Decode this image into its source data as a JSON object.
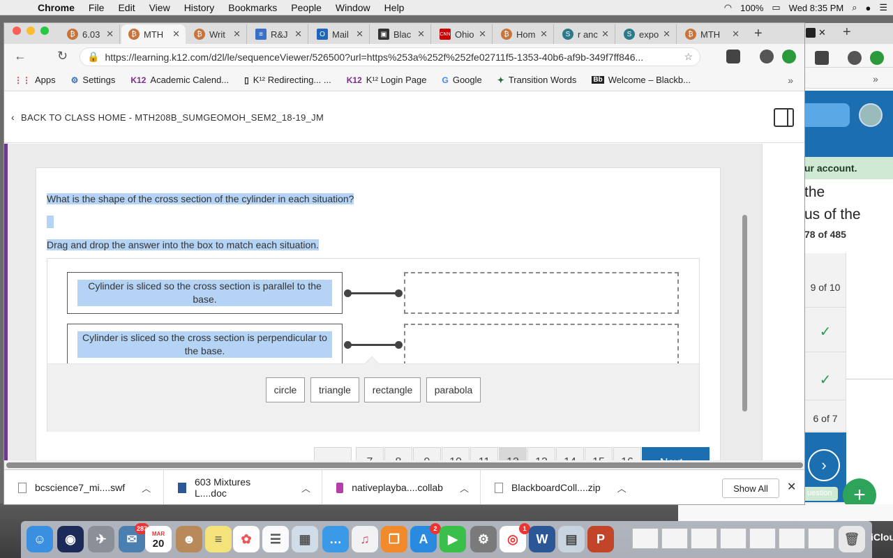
{
  "menubar": {
    "app": "Chrome",
    "items": [
      "File",
      "Edit",
      "View",
      "History",
      "Bookmarks",
      "People",
      "Window",
      "Help"
    ],
    "battery": "100%",
    "clock": "Wed 8:35 PM"
  },
  "tabs": [
    {
      "label": "6.03",
      "active": false
    },
    {
      "label": "MTH",
      "active": true
    },
    {
      "label": "Writ",
      "active": false
    },
    {
      "label": "R&J",
      "active": false
    },
    {
      "label": "Mail",
      "active": false
    },
    {
      "label": "Blac",
      "active": false
    },
    {
      "label": "Ohio",
      "active": false
    },
    {
      "label": "Hom",
      "active": false
    },
    {
      "label": "r anc",
      "active": false
    },
    {
      "label": "expo",
      "active": false
    },
    {
      "label": "MTH",
      "active": false
    }
  ],
  "address": {
    "url": "https://learning.k12.com/d2l/le/sequenceViewer/526500?url=https%253a%252f%252fe02711f5-1353-40b6-af9b-349f7ff846..."
  },
  "bookmarks": [
    {
      "icon": "apps-grid-icon",
      "label": "Apps"
    },
    {
      "icon": "gear-icon",
      "label": "Settings"
    },
    {
      "icon": "k12-icon",
      "label": "Academic Calend..."
    },
    {
      "icon": "page-icon",
      "label": "K¹² Redirecting... ..."
    },
    {
      "icon": "k12-icon",
      "label": "K¹² Login Page"
    },
    {
      "icon": "google-icon",
      "label": "Google"
    },
    {
      "icon": "feather-icon",
      "label": "Transition Words"
    },
    {
      "icon": "blackboard-icon",
      "label": "Welcome – Blackb..."
    }
  ],
  "page": {
    "back_label": "BACK TO CLASS HOME - MTH208B_SUMGEOMOH_SEM2_18-19_JM",
    "question": "What is the shape of the cross section of the cylinder in each situation?",
    "instruction": "Drag and drop the answer into the box to match each situation.",
    "prompts": [
      "Cylinder is sliced so the cross section is parallel to the base.",
      "Cylinder is sliced so the cross section is perpendicular to the base."
    ],
    "choices": [
      "circle",
      "triangle",
      "rectangle",
      "parabola"
    ],
    "pager": {
      "prev": "◂",
      "pages": [
        "7",
        "8",
        "9",
        "10",
        "11",
        "12",
        "13",
        "14",
        "15",
        "16"
      ],
      "current": "12",
      "next": "Next ▸"
    }
  },
  "background_window": {
    "banner": "ur account.",
    "line1": "the",
    "line2": "us of the",
    "count": "78 of 485",
    "row1": "9 of 10",
    "row4": "6 of 7",
    "pill": "uestion"
  },
  "downloads": [
    {
      "name": "bcscience7_mi....swf"
    },
    {
      "name": "603 Mixtures L....doc"
    },
    {
      "name": "nativeplayba....collab"
    },
    {
      "name": "BlackboardColl....zip"
    }
  ],
  "downloads_show_all": "Show All",
  "dock": {
    "mail_badge": "287",
    "calendar_month": "MAR",
    "calendar_day": "20",
    "appstore_badge": "2",
    "chrome_badge": "1",
    "icloud": "iClou"
  }
}
